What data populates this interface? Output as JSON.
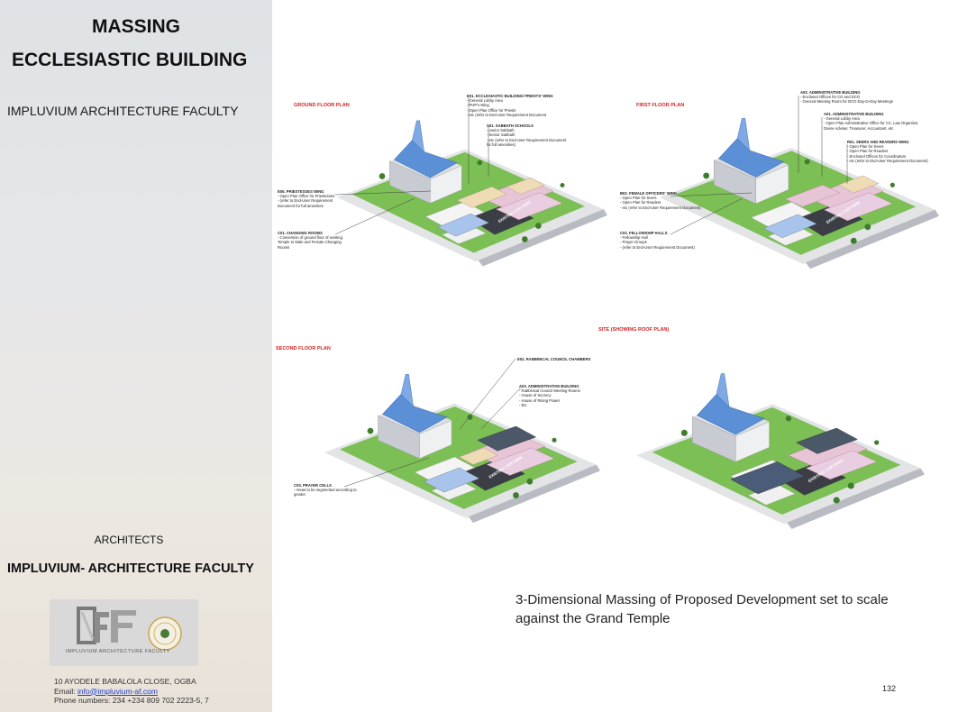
{
  "sidebar": {
    "title_line1": "MASSING",
    "title_line2": "ECCLESIASTIC BUILDING",
    "faculty_top": "IMPLUVIUM ARCHITECTURE FACULTY",
    "architects_label": "ARCHITECTS",
    "architects_name": "IMPLUVIUM- ARCHITECTURE FACULTY",
    "logo_caption": "IMPLUVIUM ARCHITECTURE FACULTY",
    "address_line": "10 AYODELE BABALOLA CLOSE, OGBA",
    "email_label": "Email: ",
    "email": "info@impluvium-af.com",
    "phone": "Phone numbers: 234 +234 809 702 2223-5, 7"
  },
  "plans": {
    "ground": {
      "label": "GROUND FLOOR PLAN",
      "note_e01": [
        "E01. ECCLESIASTIC BUILDING/ PRIESTS' WING",
        "- General Lobby Area",
        "- PHP's Wing",
        "- Open Plan Office for Priests",
        "- etc (refer to End-User Requirement Document"
      ],
      "note_s01": [
        "S01. SABBATH SCHOOLS",
        "- Junior Sabbath",
        "- Senior Sabbath",
        "- etc (refer to End-User Requirement Document",
        "  for full amenities)"
      ],
      "note_e05": [
        "E05. PRIESTESSES WING",
        "- Open Plan Office for Priestesses",
        "- (refer to End-User Requirement",
        "  Document for full amenities"
      ],
      "note_c01": [
        "C01. CHANGING ROOMS",
        "- Conversion of ground floor of existing",
        "  Temple to Male and Female Changing",
        "  Rooms"
      ]
    },
    "first": {
      "label": "FIRST FLOOR PLAN",
      "note_a02": [
        "A02. ADMINISTRATIVE BUILDING",
        "- Enclosed Offices for CO and DCO",
        "- General Meeting Room for DCO Day-to-Day Meetings"
      ],
      "note_a01": [
        "A01. ADMINISTRATIVE BUILDING",
        "- General Lobby Area",
        "- Open Plan Administrative Office for CC, Law Organiser,",
        "  Divine Adviser, Treasurer, Accountant, etc"
      ],
      "note_r01": [
        "R01. SEERS AND READERS WING",
        "- Open Plan for Seers",
        "- Open Plan for Readers",
        "- Enclosed Offices for Coordinators",
        "- etc (refer to End-User Requirement Document)"
      ],
      "note_b02": [
        "B02. FEMALE OFFICERS' WING",
        "- Open Plan for Seers",
        "- Open Plan for Readers",
        "- etc (refer to End-User Requirement Document)"
      ],
      "note_c02": [
        "C02. FELLOWSHIP HALLS",
        "- Fellowship Hall",
        "- Prayer Groups",
        "- (refer to End-User Requirement Document)"
      ]
    },
    "second": {
      "label": "SECOND FLOOR PLAN",
      "note_e02": [
        "E02. RABBINICAL COUNCIL CHAMBERS"
      ],
      "note_a03": [
        "A03. ADMINISTRATIVE BUILDING",
        "- Rabbinical Council Meeting Rooms",
        "- House of Secrecy",
        "- House of Rising Power",
        "- Etc"
      ],
      "note_c03": [
        "C03. PRAYER CELLS",
        "- Areas to be segmented according to",
        "  gender"
      ]
    },
    "roof": {
      "label": "SITE (SHOWING ROOF PLAN)"
    },
    "building_text": "EXISTING CAR PARK"
  },
  "caption": "3-Dimensional Massing of Proposed Development set to scale against the Grand Temple",
  "page_number": "132",
  "colors": {
    "plan_label": "#d42020",
    "roof_blue": "#5b8fd6",
    "grass": "#6fae4a",
    "pink": "#e7c4d6",
    "cream": "#efdcb5"
  }
}
